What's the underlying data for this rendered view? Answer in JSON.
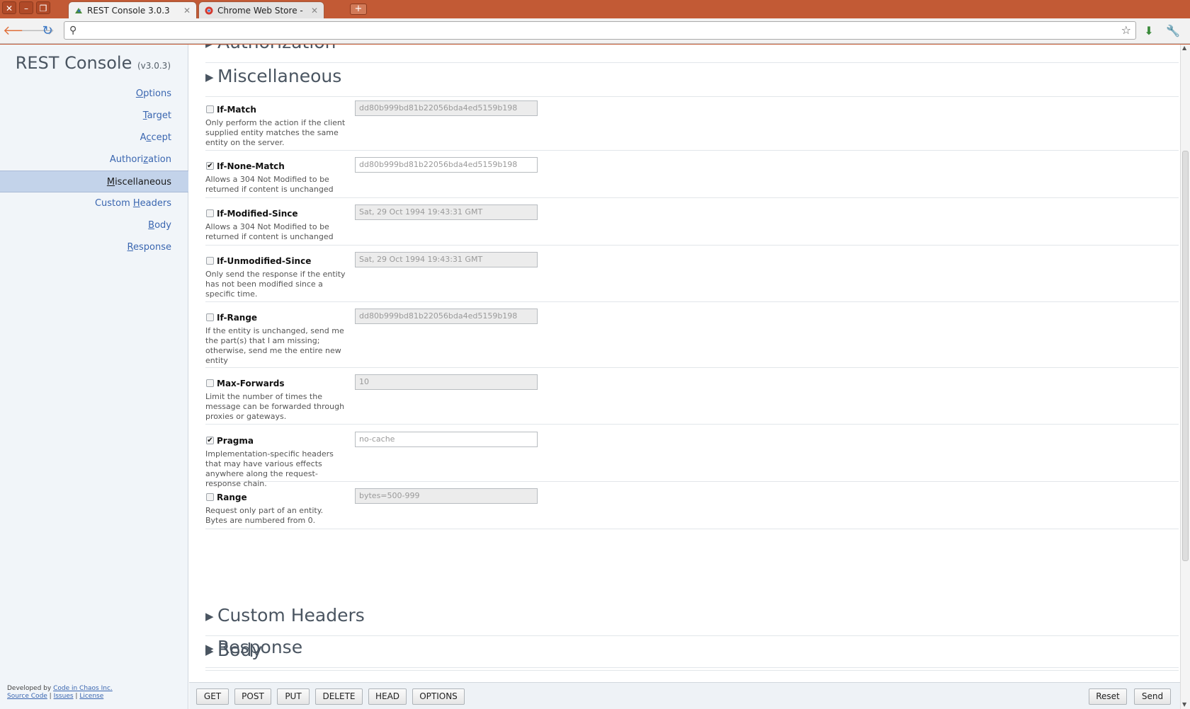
{
  "browser": {
    "tabs": [
      {
        "title": "REST Console 3.0.3",
        "active": true
      },
      {
        "title": "Chrome Web Store - Ap...",
        "active": false
      }
    ],
    "address": ""
  },
  "app": {
    "title": "REST Console",
    "version": "(v3.0.3)"
  },
  "sidebar": {
    "items": [
      {
        "label": "Options",
        "mnemonic": "O"
      },
      {
        "label": "Target",
        "mnemonic": "T"
      },
      {
        "label": "Accept",
        "mnemonic": "c"
      },
      {
        "label": "Authorization",
        "mnemonic": "z"
      },
      {
        "label": "Miscellaneous",
        "mnemonic": "M",
        "active": true
      },
      {
        "label": "Custom Headers",
        "mnemonic": "H"
      },
      {
        "label": "Body",
        "mnemonic": "B"
      },
      {
        "label": "Response",
        "mnemonic": "R"
      }
    ],
    "credits": {
      "prefix": "Developed by",
      "company": "Code in Chaos Inc.",
      "source": "Source Code",
      "issues": "Issues",
      "license": "License"
    }
  },
  "sections": {
    "authorization": "Authorization",
    "miscellaneous": "Miscellaneous",
    "custom_headers": "Custom Headers",
    "body": "Body",
    "response": "Response"
  },
  "headers": [
    {
      "name": "If-Match",
      "checked": false,
      "desc": "Only perform the action if the client supplied entity matches the same entity on the server.",
      "placeholder": "dd80b999bd81b22056bda4ed5159b198"
    },
    {
      "name": "If-None-Match",
      "checked": true,
      "desc": "Allows a 304 Not Modified to be returned if content is unchanged",
      "placeholder": "dd80b999bd81b22056bda4ed5159b198"
    },
    {
      "name": "If-Modified-Since",
      "checked": false,
      "desc": "Allows a 304 Not Modified to be returned if content is unchanged",
      "placeholder": "Sat, 29 Oct 1994 19:43:31 GMT"
    },
    {
      "name": "If-Unmodified-Since",
      "checked": false,
      "desc": "Only send the response if the entity has not been modified since a specific time.",
      "placeholder": "Sat, 29 Oct 1994 19:43:31 GMT"
    },
    {
      "name": "If-Range",
      "checked": false,
      "desc": "If the entity is unchanged, send me the part(s) that I am missing; otherwise, send me the entire new entity",
      "placeholder": "dd80b999bd81b22056bda4ed5159b198"
    },
    {
      "name": "Max-Forwards",
      "checked": false,
      "desc": "Limit the number of times the message can be forwarded through proxies or gateways.",
      "placeholder": "10"
    },
    {
      "name": "Pragma",
      "checked": true,
      "desc": "Implementation-specific headers that may have various effects anywhere along the request-response chain.",
      "placeholder": "no-cache"
    },
    {
      "name": "Range",
      "checked": false,
      "desc": "Request only part of an entity. Bytes are numbered from 0.",
      "placeholder": "bytes=500-999"
    }
  ],
  "actions": {
    "methods": [
      "GET",
      "POST",
      "PUT",
      "DELETE",
      "HEAD",
      "OPTIONS"
    ],
    "reset": "Reset",
    "send": "Send"
  },
  "colors": {
    "window_frame": "#c25a35",
    "sidebar_bg": "#f1f5f9",
    "sidebar_active": "#c3d3ea",
    "link": "#3a66b0",
    "section_text": "#4a5561"
  }
}
